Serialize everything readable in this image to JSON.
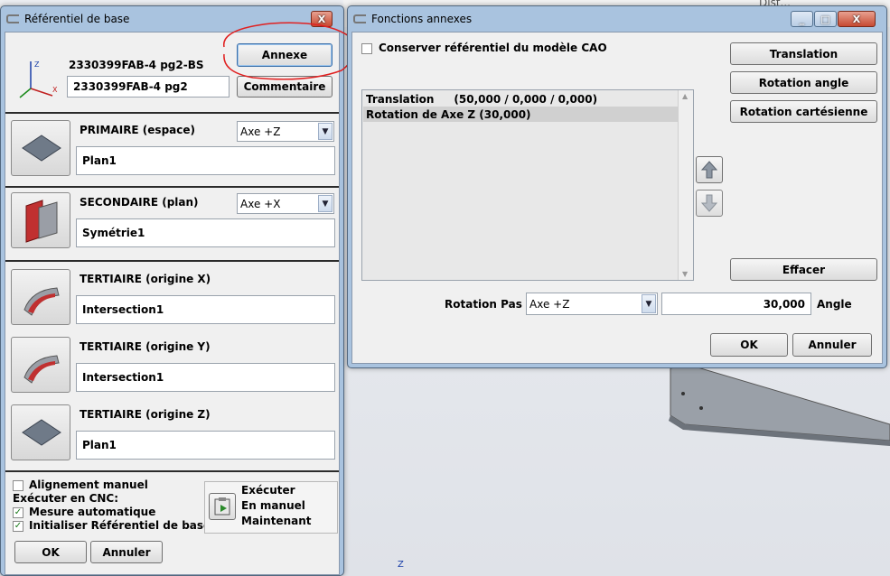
{
  "background": {
    "tab_text": "Dist...",
    "axis_z_label": "Z"
  },
  "left_window": {
    "title": "Référentiel de base",
    "buttons": {
      "minimize": "_",
      "close": "X"
    },
    "header": {
      "part_name": "2330399FAB-4 pg2-BS",
      "part_field": "2330399FAB-4 pg2",
      "annexe_label": "Annexe",
      "commentaire_label": "Commentaire",
      "axis_labels": {
        "z": "Z",
        "x": "X"
      }
    },
    "primaire": {
      "label": "PRIMAIRE (espace)",
      "axis": "Axe +Z",
      "feature": "Plan1"
    },
    "secondaire": {
      "label": "SECONDAIRE (plan)",
      "axis": "Axe +X",
      "feature": "Symétrie1"
    },
    "tertiaire_x": {
      "label": "TERTIAIRE (origine X)",
      "feature": "Intersection1"
    },
    "tertiaire_y": {
      "label": "TERTIAIRE (origine Y)",
      "feature": "Intersection1"
    },
    "tertiaire_z": {
      "label": "TERTIAIRE (origine Z)",
      "feature": "Plan1"
    },
    "bottom": {
      "alignement_manuel": {
        "label": "Alignement manuel",
        "checked": false
      },
      "executer_cnc_label": "Exécuter en CNC:",
      "mesure_auto": {
        "label": "Mesure automatique",
        "checked": true
      },
      "init_ref": {
        "label": "Initialiser Référentiel de base",
        "checked": true
      },
      "execute_box": {
        "line1": "Exécuter",
        "line2": "En manuel",
        "line3": "Maintenant"
      },
      "ok_label": "OK",
      "annuler_label": "Annuler"
    }
  },
  "right_window": {
    "title": "Fonctions annexes",
    "buttons": {
      "minimize": "_",
      "maximize": "□",
      "close": "X"
    },
    "conserver": {
      "label": "Conserver référentiel du modèle CAO",
      "checked": false
    },
    "list_items": [
      {
        "label": "Translation",
        "value": "(50,000 / 0,000 / 0,000)",
        "selected": false
      },
      {
        "label": "Rotation de Axe Z (30,000)",
        "value": "",
        "selected": true
      }
    ],
    "side_buttons": {
      "translation": "Translation",
      "rotation_angle": "Rotation angle",
      "rotation_cartesienne": "Rotation cartésienne",
      "effacer": "Effacer"
    },
    "move_up_icon": "arrow-up",
    "move_down_icon": "arrow-down",
    "rotation_pas_label": "Rotation Pas",
    "rotation_pas_axis": "Axe +Z",
    "angle_value": "30,000",
    "angle_label": "Angle",
    "ok_label": "OK",
    "annuler_label": "Annuler"
  },
  "colors": {
    "window_frame": "#a9c3df",
    "annotation_red": "#e02020",
    "selection": "#d4d4d4"
  }
}
